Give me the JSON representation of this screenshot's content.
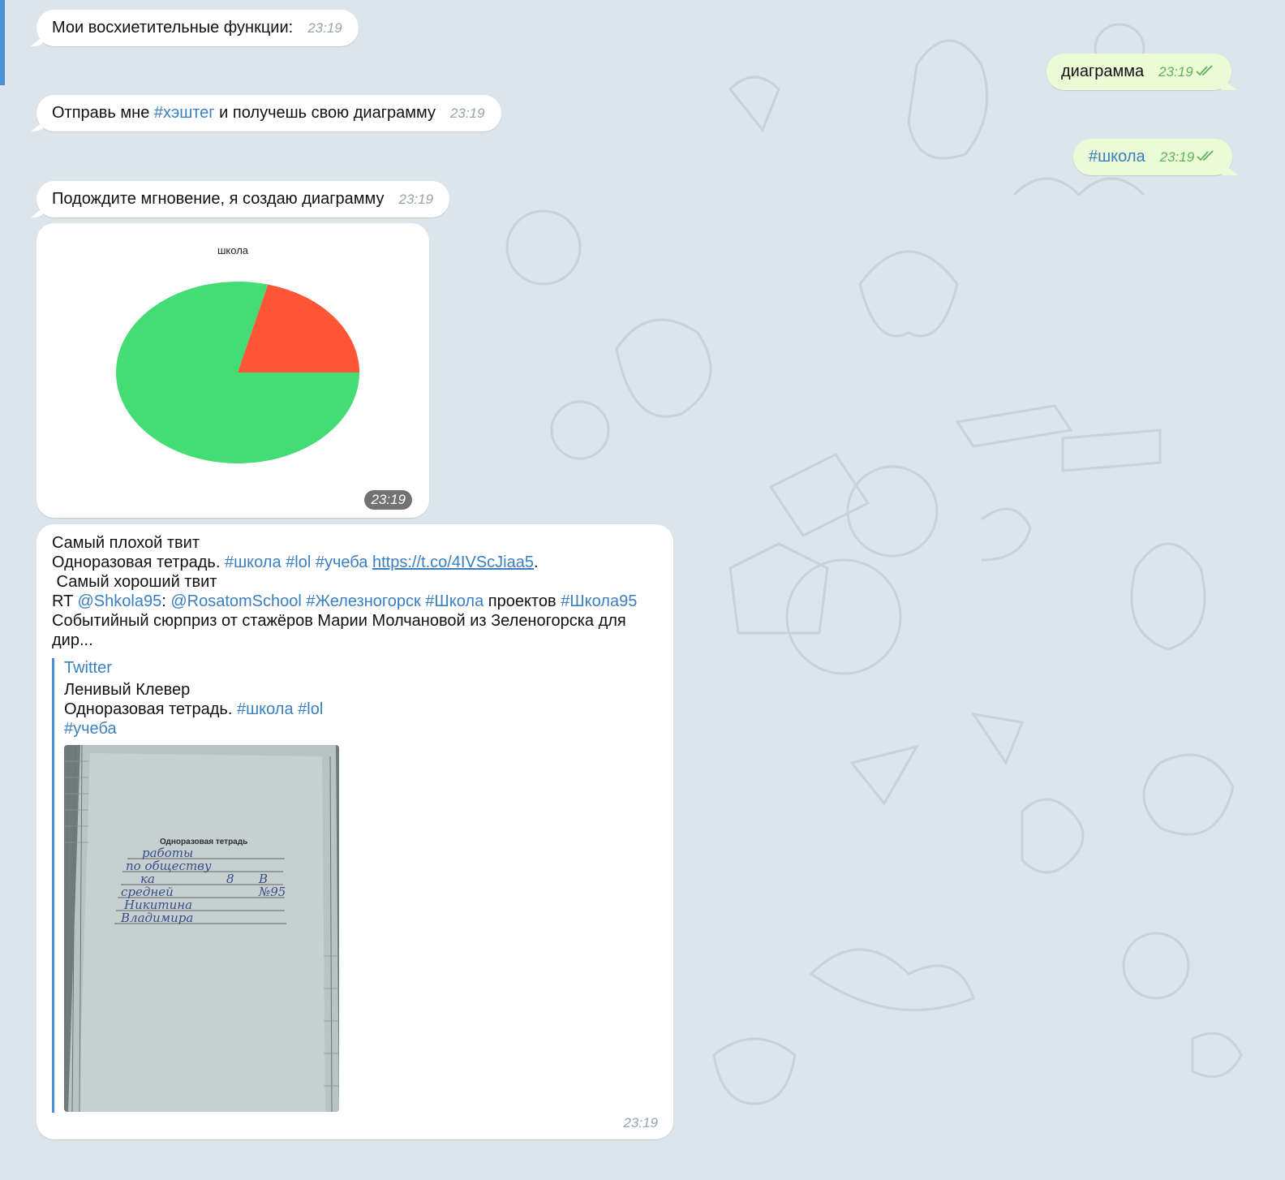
{
  "theme": {
    "background": "#dce4ec",
    "incoming_bubble": "#ffffff",
    "outgoing_bubble": "#eafbd6",
    "link_color": "#3a7fc1",
    "read_tick_color": "#63b15a"
  },
  "messages": [
    {
      "id": "m1",
      "direction": "incoming",
      "text": "Мои восхиетительные функции:",
      "time": "23:19"
    },
    {
      "id": "m2",
      "direction": "outgoing",
      "text": "диаграмма",
      "time": "23:19",
      "status": "read"
    },
    {
      "id": "m3",
      "direction": "incoming",
      "text_before": "Отправь мне ",
      "hashtag": "#хэштег",
      "text_after": " и получешь свою диаграмму",
      "time": "23:19"
    },
    {
      "id": "m4",
      "direction": "outgoing",
      "hashtag": "#школа",
      "time": "23:19",
      "status": "read"
    },
    {
      "id": "m5",
      "direction": "incoming",
      "text": "Подождите мгновение, я создаю диаграмму",
      "time": "23:19"
    },
    {
      "id": "m6",
      "direction": "incoming",
      "type": "image",
      "time": "23:19"
    },
    {
      "id": "m7",
      "direction": "incoming",
      "type": "tweet",
      "time": "23:19"
    }
  ],
  "chart_data": {
    "type": "pie",
    "title": "школа",
    "values": [
      79,
      21
    ],
    "colors": [
      "#44dc74",
      "#ff5638"
    ],
    "start_angle_deg": 0,
    "direction": "clockwise"
  },
  "tweet": {
    "line1": "Самый плохой твит",
    "line2_text": "Одноразовая тетрадь. ",
    "line2_tag1": "#школа",
    "line2_tag2": "#lol",
    "line2_tag3": "#учеба",
    "line2_link": "https://t.co/4IVScJiaa5",
    "line2_end": ".",
    "line3": " Самый хороший твит",
    "line4_rt": "RT ",
    "line4_mention1": "@Shkola95",
    "line4_colon": ": ",
    "line4_mention2": "@RosatomSchool",
    "line4_tag1": "#Железногорск",
    "line4_tag2": "#Школа",
    "line4_word": " проектов ",
    "line4_tag3": "#Школа95",
    "line5": "Событийный сюрприз от стажёров Марии Молчановой из Зеленогорска для",
    "line6": "дир...",
    "preview": {
      "site": "Twitter",
      "title": "Ленивый Клевер",
      "desc_text": "Одноразовая тетрадь. ",
      "desc_tag1": "#школа",
      "desc_tag2": "#lol",
      "desc_tag3": "#учеба"
    },
    "photo": {
      "notebook_title": "Одноразовая тетрадь",
      "line1": "работы",
      "line2": "по обществу",
      "line3_left": "ка",
      "line3_mid": "8",
      "line3_right": "В",
      "line4_left": "средней",
      "line4_right": "№95",
      "line5": "Никитина",
      "line6": "Владимира"
    }
  }
}
